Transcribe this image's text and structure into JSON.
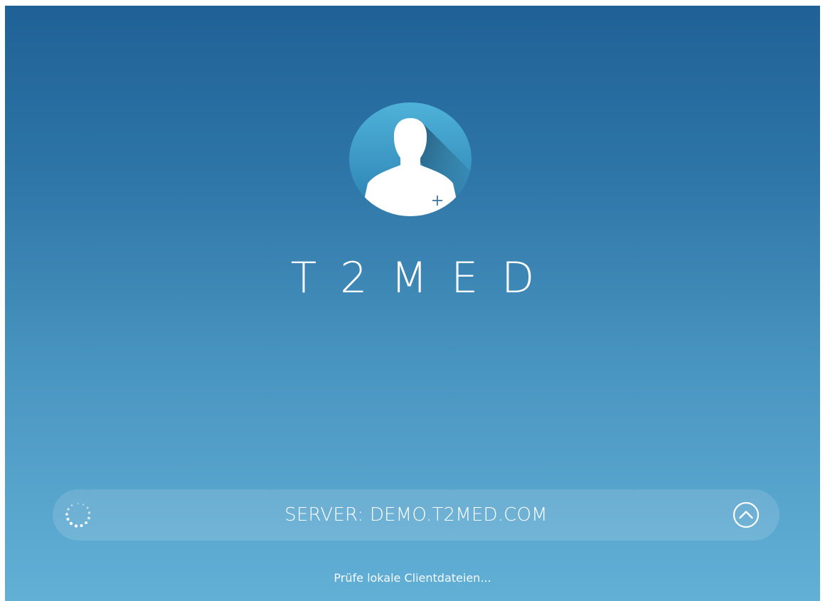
{
  "app": {
    "title": "T2MED"
  },
  "login": {
    "server_label": "SERVER: DEMO.T2MED.COM",
    "status_text": "Prüfe lokale Clientdateien..."
  },
  "icons": {
    "logo": "user-avatar-plus-icon",
    "spinner": "loading-spinner-icon",
    "expand": "chevron-up-circle-icon"
  },
  "colors": {
    "background_top": "#1f6196",
    "background_bottom": "#62b0d6",
    "logo_circle": "#3e9cc5",
    "text": "#ffffff"
  }
}
